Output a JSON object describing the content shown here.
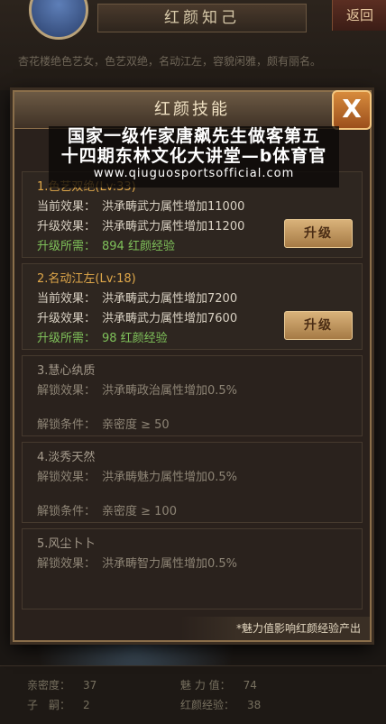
{
  "background": {
    "title": "红颜知己",
    "back_label": "返回",
    "description": "杏花楼绝色艺女，色艺双绝，名动江左，容貌闲雅，颇有丽名。",
    "stats": [
      {
        "label": "亲密度：",
        "value": "37"
      },
      {
        "label": "魅 力 值：",
        "value": "74"
      },
      {
        "label": "子　嗣：",
        "value": "2"
      },
      {
        "label": "红颜经验：",
        "value": "38"
      }
    ]
  },
  "modal": {
    "title": "红颜技能",
    "close_label": "X",
    "footer_tip": "*魅力值影响红颜经验产出",
    "skills": [
      {
        "name": "1.色艺双绝(Lv:33)",
        "current_label": "当前效果：",
        "current_value": "洪承畴武力属性增加11000",
        "next_label": "升级效果：",
        "next_value": "洪承畴武力属性增加11200",
        "req_label": "升级所需：",
        "req_value": "894  红颜经验",
        "button": "升级"
      },
      {
        "name": "2.名动江左(Lv:18)",
        "current_label": "当前效果：",
        "current_value": "洪承畴武力属性增加7200",
        "next_label": "升级效果：",
        "next_value": "洪承畴武力属性增加7600",
        "req_label": "升级所需：",
        "req_value": "98  红颜经验",
        "button": "升级"
      },
      {
        "name": "3.慧心纨质",
        "unlock_effect_label": "解锁效果：",
        "unlock_effect_value": "洪承畴政治属性增加0.5%",
        "cond_label": "解锁条件：",
        "cond_value": "亲密度 ≥ 50"
      },
      {
        "name": "4.淡秀天然",
        "unlock_effect_label": "解锁效果：",
        "unlock_effect_value": "洪承畴魅力属性增加0.5%",
        "cond_label": "解锁条件：",
        "cond_value": "亲密度 ≥ 100"
      },
      {
        "name": "5.风尘卜卜",
        "unlock_effect_label": "解锁效果：",
        "unlock_effect_value": "洪承畴智力属性增加0.5%"
      }
    ]
  },
  "watermark": {
    "line1": "国家一级作家唐飙先生做客第五",
    "line2": "十四期东林文化大讲堂—b体育官",
    "url": "www.qiuguosportsofficial.com"
  }
}
